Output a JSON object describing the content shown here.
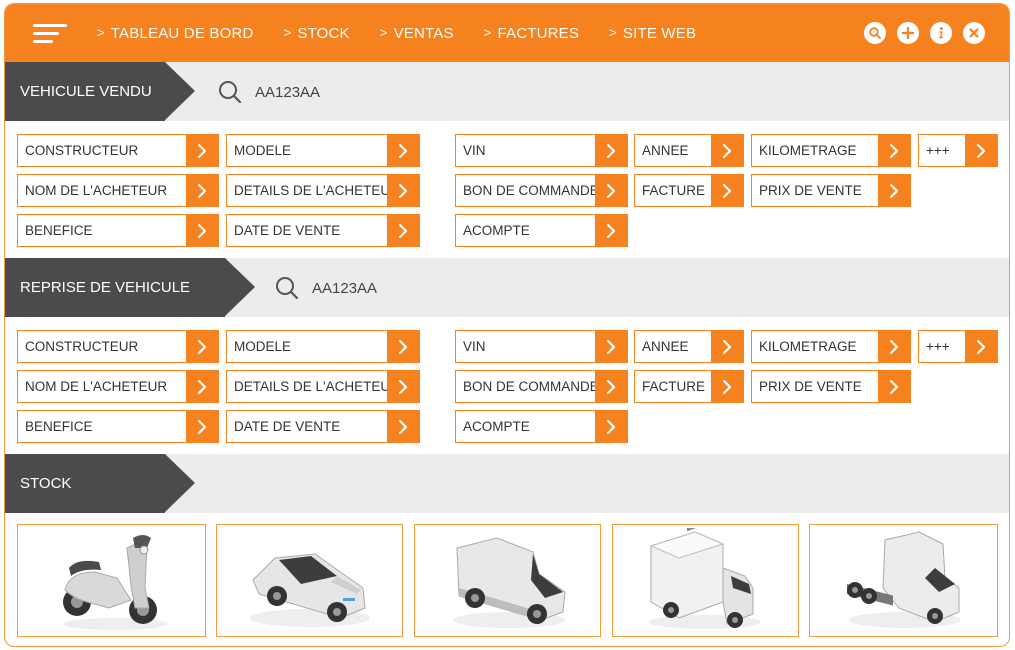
{
  "nav": {
    "menu_icon": "hamburger-icon",
    "items": [
      "TABLEAU DE BORD",
      "STOCK",
      "VENTAS",
      "FACTURES",
      "SITE WEB"
    ],
    "actions": [
      {
        "icon": "search-icon"
      },
      {
        "icon": "add-icon"
      },
      {
        "icon": "info-icon"
      },
      {
        "icon": "close-icon"
      }
    ]
  },
  "sections": [
    {
      "title": "VEHICULE VENDU",
      "search_value": "AA123AA",
      "fields": [
        "CONSTRUCTEUR",
        "MODELE",
        "VIN",
        "ANNEE",
        "KILOMETRAGE",
        "+++",
        "NOM DE L'ACHETEUR",
        "DETAILS DE L'ACHETEUR",
        "BON DE COMMANDE",
        "FACTURE",
        "PRIX DE VENTE",
        "BENEFICE",
        "DATE DE VENTE",
        "ACOMPTE"
      ]
    },
    {
      "title": "REPRISE DE VEHICULE",
      "search_value": "AA123AA",
      "fields": [
        "CONSTRUCTEUR",
        "MODELE",
        "VIN",
        "ANNEE",
        "KILOMETRAGE",
        "+++",
        "NOM DE L'ACHETEUR",
        "DETAILS DE L'ACHETEUR",
        "BON DE COMMANDE",
        "FACTURE",
        "PRIX DE VENTE",
        "BENEFICE",
        "DATE DE VENTE",
        "ACOMPTE"
      ]
    }
  ],
  "stock": {
    "title": "STOCK",
    "vehicles": [
      {
        "icon": "scooter-icon"
      },
      {
        "icon": "car-icon"
      },
      {
        "icon": "van-icon"
      },
      {
        "icon": "truck-icon"
      },
      {
        "icon": "semi-truck-icon"
      }
    ]
  },
  "colors": {
    "accent": "#f5821f",
    "dark_tab": "#4b4b4d",
    "header_bg": "#ececec"
  }
}
